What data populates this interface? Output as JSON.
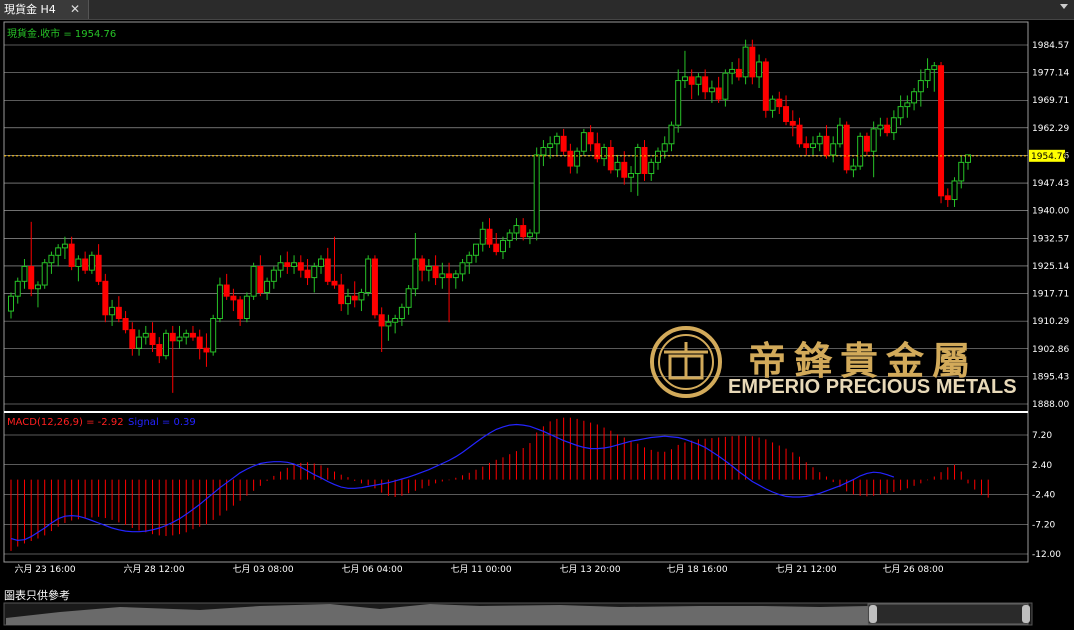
{
  "tab": {
    "title": "現貨金 H4",
    "close": "✕"
  },
  "price_label": "現貨金.收市 = 1954.76",
  "current_price": "1954.76",
  "macd_label": "MACD(12,26,9) = -2.92",
  "signal_label": "Signal = 0.39",
  "footer_note": "圖表只供參考",
  "logo": {
    "cn": "帝鋒貴金屬",
    "en": "EMPERIO PRECIOUS METALS"
  },
  "colors": {
    "bull": "#27c227",
    "bear": "#ff0000",
    "signal": "#2424ff",
    "price_line": "#ffbf00",
    "grid": "#b4b4b4"
  },
  "price_axis": [
    "1984.57",
    "1977.14",
    "1969.71",
    "1962.29",
    "1954.86",
    "1947.43",
    "1940.00",
    "1932.57",
    "1925.14",
    "1917.71",
    "1910.29",
    "1902.86",
    "1895.43",
    "1888.00"
  ],
  "macd_axis": [
    "7.20",
    "2.40",
    "-2.40",
    "-7.20",
    "-12.00"
  ],
  "x_axis": [
    "六月 23 16:00",
    "六月 28 12:00",
    "七月 03 08:00",
    "七月 06 04:00",
    "七月 11 00:00",
    "七月 13 20:00",
    "七月 18 16:00",
    "七月 21 12:00",
    "七月 26 08:00"
  ],
  "chart_data": {
    "type": "candlestick",
    "title": "現貨金 H4",
    "ylim": [
      1888.0,
      1988.0
    ],
    "candles": [
      [
        1913,
        1918,
        1911,
        1917
      ],
      [
        1917,
        1922,
        1915,
        1921
      ],
      [
        1921,
        1927,
        1919,
        1925
      ],
      [
        1925,
        1937,
        1917,
        1919
      ],
      [
        1919,
        1921,
        1914,
        1920
      ],
      [
        1920,
        1927,
        1919,
        1926
      ],
      [
        1926,
        1929,
        1923,
        1928
      ],
      [
        1928,
        1931,
        1925,
        1930
      ],
      [
        1930,
        1933,
        1927,
        1931
      ],
      [
        1931,
        1933,
        1924,
        1925
      ],
      [
        1925,
        1928,
        1921,
        1927
      ],
      [
        1927,
        1929,
        1923,
        1924
      ],
      [
        1924,
        1929,
        1923,
        1928
      ],
      [
        1928,
        1931,
        1920,
        1921
      ],
      [
        1921,
        1923,
        1910,
        1912
      ],
      [
        1912,
        1916,
        1909,
        1914
      ],
      [
        1914,
        1917,
        1910,
        1911
      ],
      [
        1911,
        1913,
        1907,
        1908
      ],
      [
        1908,
        1910,
        1901,
        1903
      ],
      [
        1903,
        1908,
        1901,
        1906
      ],
      [
        1906,
        1909,
        1904,
        1907
      ],
      [
        1907,
        1910,
        1902,
        1904
      ],
      [
        1904,
        1906,
        1899,
        1901
      ],
      [
        1901,
        1908,
        1900,
        1907
      ],
      [
        1907,
        1909,
        1891,
        1905
      ],
      [
        1905,
        1909,
        1903,
        1906
      ],
      [
        1906,
        1908,
        1904,
        1907
      ],
      [
        1907,
        1909,
        1905,
        1906
      ],
      [
        1906,
        1908,
        1900,
        1903
      ],
      [
        1903,
        1907,
        1898,
        1902
      ],
      [
        1902,
        1912,
        1901,
        1911
      ],
      [
        1911,
        1922,
        1910,
        1920
      ],
      [
        1920,
        1923,
        1916,
        1917
      ],
      [
        1917,
        1919,
        1913,
        1916
      ],
      [
        1916,
        1917,
        1909,
        1911
      ],
      [
        1911,
        1918,
        1910,
        1917
      ],
      [
        1917,
        1926,
        1916,
        1925
      ],
      [
        1925,
        1928,
        1917,
        1918
      ],
      [
        1918,
        1922,
        1916,
        1921
      ],
      [
        1921,
        1925,
        1919,
        1924
      ],
      [
        1924,
        1928,
        1922,
        1926
      ],
      [
        1926,
        1929,
        1923,
        1925
      ],
      [
        1925,
        1928,
        1923,
        1926
      ],
      [
        1926,
        1928,
        1922,
        1924
      ],
      [
        1924,
        1927,
        1920,
        1922
      ],
      [
        1922,
        1926,
        1918,
        1925
      ],
      [
        1925,
        1928,
        1923,
        1927
      ],
      [
        1927,
        1930,
        1920,
        1921
      ],
      [
        1921,
        1933,
        1919,
        1920
      ],
      [
        1920,
        1923,
        1913,
        1915
      ],
      [
        1915,
        1919,
        1912,
        1917
      ],
      [
        1917,
        1921,
        1914,
        1916
      ],
      [
        1916,
        1919,
        1913,
        1918
      ],
      [
        1918,
        1928,
        1917,
        1927
      ],
      [
        1927,
        1928,
        1911,
        1912
      ],
      [
        1912,
        1914,
        1902,
        1909
      ],
      [
        1909,
        1912,
        1905,
        1910
      ],
      [
        1910,
        1912,
        1907,
        1911
      ],
      [
        1911,
        1915,
        1909,
        1914
      ],
      [
        1914,
        1920,
        1912,
        1919
      ],
      [
        1919,
        1934,
        1917,
        1927
      ],
      [
        1927,
        1928,
        1921,
        1924
      ],
      [
        1924,
        1927,
        1921,
        1925
      ],
      [
        1925,
        1928,
        1920,
        1922
      ],
      [
        1922,
        1926,
        1919,
        1923
      ],
      [
        1923,
        1926,
        1910,
        1922
      ],
      [
        1922,
        1924,
        1919,
        1923
      ],
      [
        1923,
        1927,
        1921,
        1926
      ],
      [
        1926,
        1929,
        1923,
        1928
      ],
      [
        1928,
        1931,
        1926,
        1931
      ],
      [
        1931,
        1937,
        1929,
        1935
      ],
      [
        1935,
        1938,
        1930,
        1931
      ],
      [
        1931,
        1934,
        1928,
        1929
      ],
      [
        1929,
        1933,
        1927,
        1932
      ],
      [
        1932,
        1935,
        1930,
        1934
      ],
      [
        1934,
        1938,
        1932,
        1936
      ],
      [
        1936,
        1938,
        1932,
        1933
      ],
      [
        1933,
        1935,
        1931,
        1934
      ],
      [
        1934,
        1957,
        1932,
        1955
      ],
      [
        1955,
        1959,
        1952,
        1957
      ],
      [
        1957,
        1960,
        1954,
        1958
      ],
      [
        1958,
        1961,
        1955,
        1960
      ],
      [
        1960,
        1962,
        1955,
        1956
      ],
      [
        1956,
        1958,
        1950,
        1952
      ],
      [
        1952,
        1957,
        1950,
        1956
      ],
      [
        1956,
        1962,
        1955,
        1961
      ],
      [
        1961,
        1963,
        1956,
        1958
      ],
      [
        1958,
        1961,
        1953,
        1954
      ],
      [
        1954,
        1958,
        1952,
        1957
      ],
      [
        1957,
        1959,
        1950,
        1951
      ],
      [
        1951,
        1955,
        1949,
        1953
      ],
      [
        1953,
        1956,
        1947,
        1949
      ],
      [
        1949,
        1952,
        1945,
        1950
      ],
      [
        1950,
        1958,
        1944,
        1957
      ],
      [
        1957,
        1959,
        1948,
        1950
      ],
      [
        1950,
        1954,
        1948,
        1953
      ],
      [
        1953,
        1957,
        1951,
        1956
      ],
      [
        1956,
        1960,
        1954,
        1958
      ],
      [
        1958,
        1964,
        1956,
        1963
      ],
      [
        1963,
        1978,
        1961,
        1975
      ],
      [
        1975,
        1983,
        1973,
        1976
      ],
      [
        1976,
        1978,
        1970,
        1974
      ],
      [
        1974,
        1977,
        1971,
        1976
      ],
      [
        1976,
        1978,
        1970,
        1972
      ],
      [
        1972,
        1975,
        1969,
        1973
      ],
      [
        1973,
        1976,
        1969,
        1970
      ],
      [
        1970,
        1978,
        1968,
        1977
      ],
      [
        1977,
        1980,
        1974,
        1978
      ],
      [
        1978,
        1981,
        1975,
        1976
      ],
      [
        1976,
        1986,
        1974,
        1984
      ],
      [
        1984,
        1986,
        1974,
        1976
      ],
      [
        1976,
        1982,
        1973,
        1980
      ],
      [
        1980,
        1981,
        1965,
        1967
      ],
      [
        1967,
        1971,
        1965,
        1970
      ],
      [
        1970,
        1972,
        1966,
        1968
      ],
      [
        1968,
        1971,
        1963,
        1964
      ],
      [
        1964,
        1967,
        1960,
        1963
      ],
      [
        1963,
        1965,
        1957,
        1958
      ],
      [
        1958,
        1960,
        1955,
        1957
      ],
      [
        1957,
        1960,
        1955,
        1958
      ],
      [
        1958,
        1961,
        1956,
        1960
      ],
      [
        1960,
        1963,
        1954,
        1955
      ],
      [
        1955,
        1960,
        1953,
        1958
      ],
      [
        1958,
        1965,
        1957,
        1963
      ],
      [
        1963,
        1964,
        1950,
        1951
      ],
      [
        1951,
        1954,
        1949,
        1952
      ],
      [
        1952,
        1961,
        1951,
        1960
      ],
      [
        1960,
        1961,
        1955,
        1956
      ],
      [
        1956,
        1964,
        1949,
        1962
      ],
      [
        1962,
        1965,
        1960,
        1963
      ],
      [
        1963,
        1965,
        1960,
        1961
      ],
      [
        1961,
        1967,
        1959,
        1965
      ],
      [
        1965,
        1971,
        1963,
        1968
      ],
      [
        1968,
        1971,
        1965,
        1969
      ],
      [
        1969,
        1973,
        1967,
        1972
      ],
      [
        1972,
        1978,
        1968,
        1975
      ],
      [
        1975,
        1981,
        1973,
        1978
      ],
      [
        1978,
        1980,
        1972,
        1979
      ],
      [
        1979,
        1980,
        1942,
        1944
      ],
      [
        1944,
        1946,
        1941,
        1943
      ],
      [
        1943,
        1949,
        1941,
        1948
      ],
      [
        1948,
        1955,
        1946,
        1953
      ],
      [
        1953,
        1955,
        1951,
        1955
      ]
    ],
    "macd": [
      -11.5,
      -10.8,
      -10.3,
      -9.9,
      -9.5,
      -9.0,
      -8.3,
      -7.6,
      -7.0,
      -6.6,
      -6.4,
      -6.2,
      -6.1,
      -6.0,
      -6.2,
      -6.5,
      -6.9,
      -7.3,
      -7.8,
      -8.2,
      -8.5,
      -8.8,
      -9.0,
      -9.1,
      -9.0,
      -8.8,
      -8.5,
      -8.0,
      -7.6,
      -7.2,
      -6.5,
      -5.8,
      -5.0,
      -4.2,
      -3.4,
      -2.6,
      -1.8,
      -1.0,
      -0.2,
      0.6,
      1.3,
      1.9,
      2.4,
      2.7,
      2.8,
      2.6,
      2.3,
      1.9,
      1.3,
      0.8,
      0.4,
      -0.2,
      -0.6,
      -0.9,
      -1.4,
      -2.1,
      -2.6,
      -2.8,
      -2.6,
      -2.2,
      -1.8,
      -1.4,
      -1.0,
      -0.6,
      -0.3,
      -0.1,
      0.3,
      0.7,
      1.1,
      1.6,
      2.1,
      2.7,
      3.2,
      3.6,
      4.1,
      4.6,
      5.1,
      5.9,
      7.6,
      8.6,
      9.4,
      9.8,
      10.0,
      10.0,
      9.8,
      9.5,
      9.2,
      8.9,
      8.4,
      7.9,
      7.3,
      6.8,
      6.2,
      5.8,
      5.2,
      4.8,
      4.5,
      4.5,
      4.9,
      5.6,
      6.0,
      6.3,
      6.5,
      6.6,
      6.7,
      6.8,
      6.9,
      7.0,
      7.1,
      7.0,
      7.0,
      6.8,
      6.5,
      6.0,
      5.5,
      5.0,
      4.4,
      3.7,
      2.8,
      2.0,
      1.2,
      0.5,
      -0.4,
      -1.2,
      -1.9,
      -2.4,
      -2.6,
      -2.7,
      -2.6,
      -2.4,
      -2.2,
      -2.0,
      -1.7,
      -1.4,
      -1.0,
      -0.6,
      -0.1,
      0.5,
      1.2,
      2.0,
      2.4,
      1.3,
      -0.6,
      -1.6,
      -2.5,
      -2.9
    ],
    "signal": [
      -9.5,
      -9.8,
      -9.7,
      -9.2,
      -8.5,
      -7.8,
      -7.0,
      -6.3,
      -5.9,
      -5.8,
      -5.9,
      -6.2,
      -6.6,
      -7.0,
      -7.4,
      -7.8,
      -8.1,
      -8.3,
      -8.4,
      -8.4,
      -8.3,
      -8.1,
      -7.8,
      -7.4,
      -6.9,
      -6.3,
      -5.6,
      -4.8,
      -4.0,
      -3.1,
      -2.2,
      -1.3,
      -0.5,
      0.3,
      1.1,
      1.7,
      2.2,
      2.6,
      2.8,
      2.9,
      2.9,
      2.8,
      2.5,
      2.0,
      1.4,
      0.8,
      0.3,
      -0.3,
      -0.8,
      -1.2,
      -1.4,
      -1.4,
      -1.3,
      -1.1,
      -0.9,
      -0.7,
      -0.5,
      -0.2,
      0.1,
      0.4,
      0.8,
      1.2,
      1.6,
      2.1,
      2.6,
      3.1,
      3.7,
      4.4,
      5.2,
      6.0,
      6.8,
      7.5,
      8.1,
      8.5,
      8.8,
      8.9,
      8.8,
      8.6,
      8.2,
      7.8,
      7.3,
      6.8,
      6.3,
      5.9,
      5.5,
      5.2,
      5.0,
      5.0,
      5.1,
      5.3,
      5.6,
      5.9,
      6.2,
      6.4,
      6.6,
      6.8,
      6.9,
      7.0,
      6.9,
      6.8,
      6.5,
      6.1,
      5.7,
      5.2,
      4.5,
      3.8,
      3.0,
      2.2,
      1.3,
      0.5,
      -0.3,
      -0.9,
      -1.5,
      -2.0,
      -2.4,
      -2.7,
      -2.8,
      -2.8,
      -2.7,
      -2.5,
      -2.2,
      -1.8,
      -1.4,
      -1.0,
      -0.5,
      0.0,
      0.6,
      1.0,
      1.2,
      1.1,
      0.8,
      0.4
    ]
  }
}
